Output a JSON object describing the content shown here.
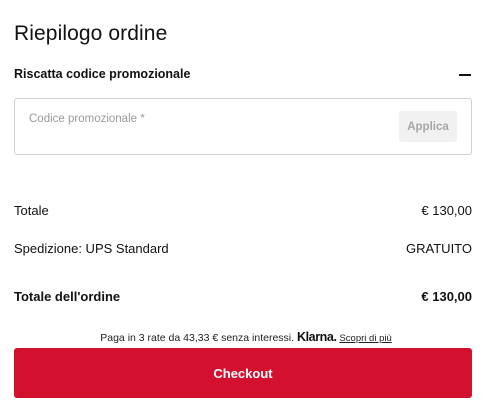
{
  "title": "Riepilogo ordine",
  "promo": {
    "toggle_label": "Riscatta codice promozionale",
    "input_placeholder": "Codice promozionale *",
    "input_value": "",
    "apply_label": "Applica"
  },
  "summary": {
    "total_label": "Totale",
    "total_value": "€ 130,00",
    "shipping_label": "Spedizione: UPS Standard",
    "shipping_value": "GRATUITO",
    "order_total_label": "Totale dell'ordine",
    "order_total_value": "€ 130,00"
  },
  "klarna": {
    "text": "Paga in 3 rate da 43,33 € senza interessi.",
    "logo_text": "Klarna.",
    "link_text": "Scopri di più"
  },
  "checkout_label": "Checkout",
  "colors": {
    "accent": "#d4102f",
    "border": "#cfcfcf",
    "apply_bg": "#f1f1f1",
    "apply_text": "#a6a6a6"
  }
}
